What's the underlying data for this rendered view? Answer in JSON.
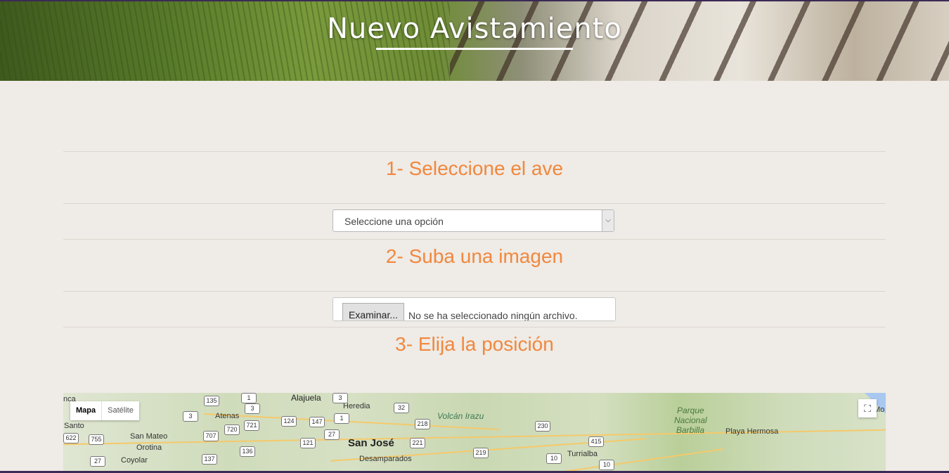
{
  "header": {
    "title": "Nuevo Avistamiento"
  },
  "section1": {
    "heading": "1- Seleccione el ave",
    "select_value": "Seleccione una opción"
  },
  "section2": {
    "heading": "2- Suba una imagen",
    "file_button": "Examinar...",
    "file_status": "No se ha seleccionado ningún archivo."
  },
  "section3": {
    "heading": "3- Elija la posición"
  },
  "map": {
    "type_map": "Mapa",
    "type_satellite": "Satélite",
    "labels": {
      "alajuela": "Alajuela",
      "heredia": "Heredia",
      "volcan": "Volcán Irazu",
      "parque": "Parque",
      "nacional": "Nacional",
      "barbilla": "Barbilla",
      "playa_hermosa": "Playa Hermosa",
      "santo": "Santo",
      "atenas": "Atenas",
      "san_mateo": "San Mateo",
      "orotina": "Orotina",
      "coyolar": "Coyolar",
      "san_jose": "San José",
      "desamparados": "Desamparados",
      "turrialba": "Turrialba",
      "nca": "nca",
      "mo": "Mo"
    },
    "shields": {
      "s1": "135",
      "s2": "3",
      "s3": "1",
      "s4": "3",
      "s5": "32",
      "s6": "3",
      "s7": "720",
      "s8": "721",
      "s9": "124",
      "s10": "147",
      "s11": "1",
      "s12": "218",
      "s13": "230",
      "s14": "622",
      "s15": "755",
      "s16": "707",
      "s17": "121",
      "s18": "27",
      "s19": "221",
      "s20": "415",
      "s21": "136",
      "s22": "27",
      "s23": "137",
      "s24": "219",
      "s25": "10",
      "s26": "10"
    }
  },
  "colors": {
    "accent": "#f0883e",
    "background": "#efebe6"
  }
}
